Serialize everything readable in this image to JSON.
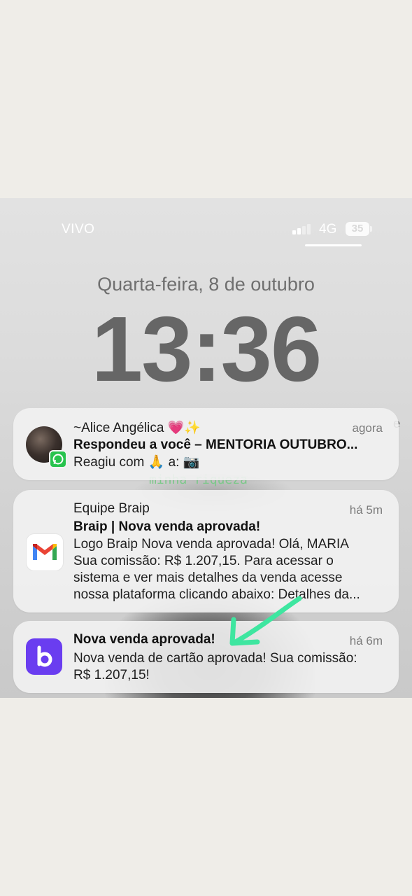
{
  "status_bar": {
    "carrier": "VIVO",
    "network": "4G",
    "battery": "35"
  },
  "lock_screen": {
    "date": "Quarta-feira, 8 de outubro",
    "time": "13:36",
    "behind_text": "minha riqueza"
  },
  "notifications": [
    {
      "app_icon": "whatsapp-contact-avatar",
      "sender": "~Alice Angélica 💗✨",
      "time_ago": "agora",
      "title": "Respondeu a você – MENTORIA OUTUBRO...",
      "body": "Reagiu com 🙏 a: 📷"
    },
    {
      "app_icon": "gmail-icon",
      "sender": "Equipe Braip",
      "time_ago": "há 5m",
      "title": "Braip | Nova venda aprovada!",
      "body_lines": [
        "Logo Braip Nova venda aprovada! Olá, MARIA",
        "Sua comissão: R$ 1.207,15. Para acessar o",
        "sistema e ver mais detalhes da venda acesse",
        "nossa plataforma clicando abaixo: Detalhes da..."
      ]
    },
    {
      "app_icon": "braip-icon",
      "title": "Nova venda aprovada!",
      "time_ago": "há 6m",
      "body_lines": [
        "Nova venda de cartão aprovada! Sua comissão:",
        "R$ 1.207,15!"
      ]
    }
  ],
  "annotation": {
    "arrow_color": "#3ee6a0"
  }
}
